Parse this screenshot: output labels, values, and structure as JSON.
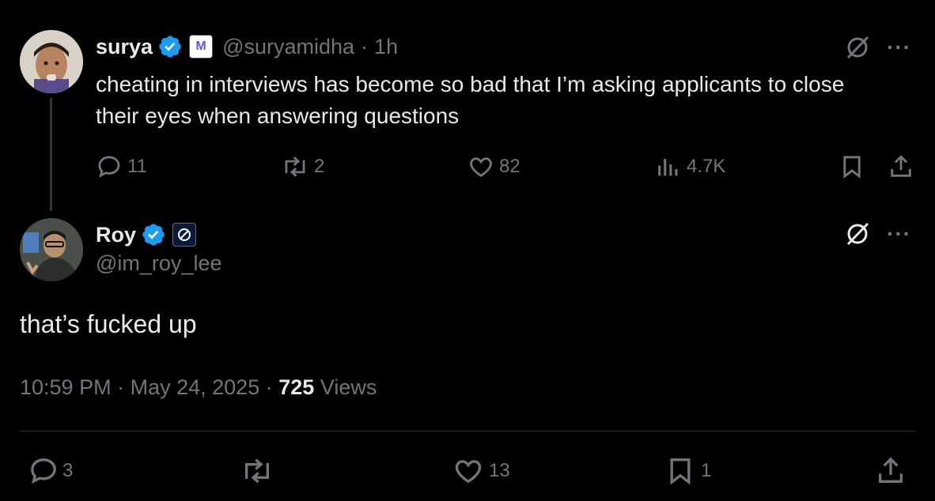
{
  "parent_tweet": {
    "author_name": "surya",
    "affiliate_badge": "M",
    "handle": "@suryamidha",
    "separator": "·",
    "time": "1h",
    "text": "cheating in interviews has become so bad that I’m asking applicants to close their eyes when answering questions",
    "replies": "11",
    "reposts": "2",
    "likes": "82",
    "views": "4.7K"
  },
  "reply_tweet": {
    "author_name": "Roy",
    "handle": "@im_roy_lee",
    "text": "that’s fucked up",
    "time": "10:59 PM",
    "sep1": "·",
    "date": "May 24, 2025",
    "sep2": "·",
    "views_count": "725",
    "views_label": "Views",
    "replies": "3",
    "likes": "13",
    "bookmarks": "1"
  },
  "colors": {
    "verified": "#1d9bf0",
    "muted": "#71767b",
    "text": "#e7e9ea",
    "background": "#000000"
  }
}
